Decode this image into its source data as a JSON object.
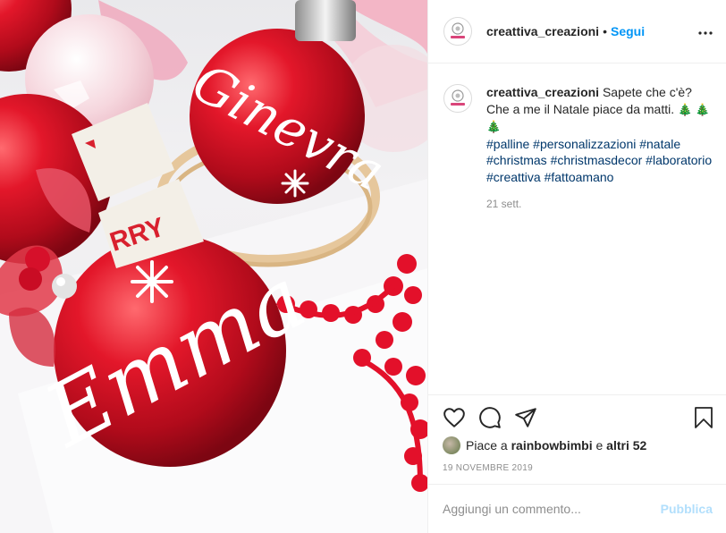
{
  "post": {
    "photo_alt": "Palline di Natale rosse personalizzate",
    "ornament_names": [
      "Ginevra",
      "Emma"
    ],
    "ribbon_text": "RRY"
  },
  "header": {
    "username": "creattiva_creazioni",
    "dot": "•",
    "follow_label": "Segui"
  },
  "caption": {
    "username": "creattiva_creazioni",
    "text": "Sapete che c'è? Che a me il Natale piace da matti.",
    "emoji": "🎄 🎄 🎄",
    "hashtags": [
      "#palline",
      "#personalizzazioni",
      "#natale",
      "#christmas",
      "#christmasdecor",
      "#laboratorio",
      "#creattiva",
      "#fattoamano"
    ],
    "time": "21 sett."
  },
  "actions": {
    "like_icon": "heart-icon",
    "comment_icon": "comment-icon",
    "share_icon": "paper-plane-icon",
    "save_icon": "bookmark-icon"
  },
  "likes": {
    "prefix": "Piace a",
    "user": "rainbowbimbi",
    "connector": "e",
    "others": "altri 52"
  },
  "date": "19 NOVEMBRE 2019",
  "comment": {
    "placeholder": "Aggiungi un commento...",
    "publish_label": "Pubblica"
  },
  "colors": {
    "link": "#0095f6",
    "hashtag": "#00376b",
    "publish_disabled": "#b2dffc",
    "ornament_red": "#d31225"
  }
}
